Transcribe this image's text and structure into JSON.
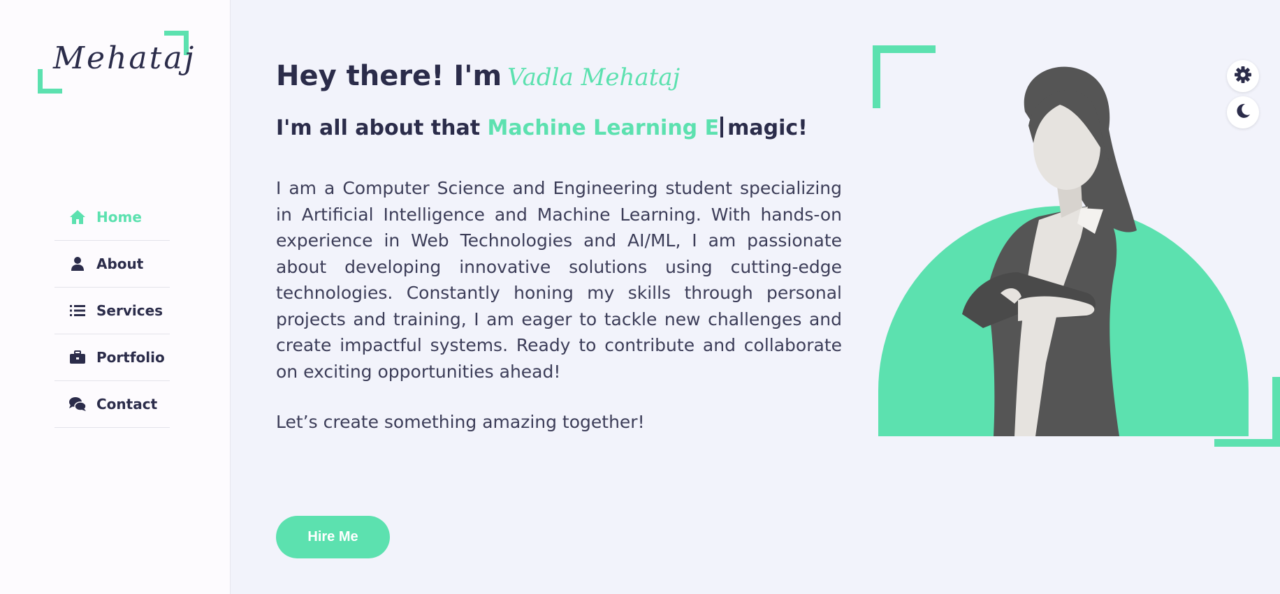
{
  "brand": {
    "logo_text": "Mehataj"
  },
  "nav": {
    "items": [
      {
        "label": "Home",
        "icon": "home-icon",
        "active": true
      },
      {
        "label": "About",
        "icon": "user-icon",
        "active": false
      },
      {
        "label": "Services",
        "icon": "list-icon",
        "active": false
      },
      {
        "label": "Portfolio",
        "icon": "briefcase-icon",
        "active": false
      },
      {
        "label": "Contact",
        "icon": "comments-icon",
        "active": false
      }
    ]
  },
  "hero": {
    "greeting": "Hey there! I'm",
    "name": "Vadla Mehataj",
    "tagline_prefix": "I'm all about that",
    "tagline_highlight": "Machine Learning E",
    "tagline_suffix": "magic!",
    "bio": "I am a Computer Science and Engineering student specializing in Artificial Intelligence and Machine Learning. With hands-on experience in Web Technologies and AI/ML, I am passionate about developing innovative solutions using cutting-edge technologies. Constantly honing my skills through personal projects and training, I am eager to tackle new challenges and create impactful systems. Ready to contribute and collaborate on exciting opportunities ahead!",
    "cta_text": "Let’s create something amazing together!",
    "hire_button": "Hire Me"
  },
  "floating_controls": {
    "settings_icon": "gear-icon",
    "theme_icon": "moon-icon"
  },
  "colors": {
    "accent": "#5ce1af",
    "text": "#2b2c4a",
    "background": "#f2f3fb",
    "sidebar": "#fdfbfe"
  }
}
